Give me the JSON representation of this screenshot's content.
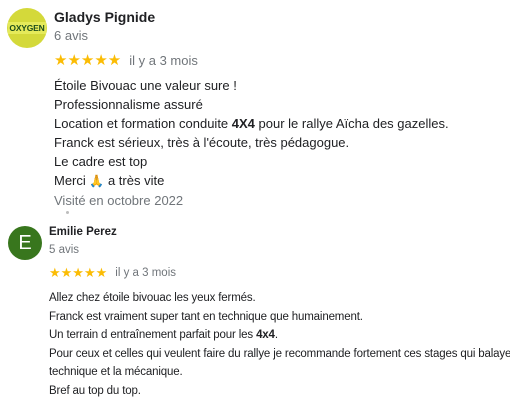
{
  "reviews": [
    {
      "avatar_brand": "OXYGEN",
      "author": "Gladys Pignide",
      "review_count": "6 avis",
      "stars": "★★★★★",
      "time": "il y a 3 mois",
      "lines": {
        "l1": "Étoile Bivouac une valeur sure !",
        "l2": "Professionnalisme assuré",
        "l3a": "Location et formation conduite ",
        "l3b": "4X4",
        "l3c": " pour le rallye Aïcha des gazelles.",
        "l4": "Franck est sérieux, très à l'écoute, très pédagogue.",
        "l5": "Le cadre est top",
        "l6a": "Merci ",
        "l6_emoji": "🙏",
        "l6b": " a très vite"
      },
      "visited": "Visité en octobre 2022"
    },
    {
      "avatar_letter": "E",
      "avatar_color": "#38761d",
      "author": "Emilie Perez",
      "review_count": "5 avis",
      "stars": "★★★★★",
      "time": "il y a 3 mois",
      "lines": {
        "l1": "Allez chez étoile bivouac les yeux fermés.",
        "l2": "Franck est vraiment super tant en technique que humainement.",
        "l3a": "Un terrain d entraînement parfait pour les ",
        "l3b": "4x4",
        "l3c": ".",
        "l4": "Pour ceux et celles qui veulent faire du rallye je recommande fortement ces stages qui balaye la",
        "l5": "technique et la mécanique.",
        "l6": "Bref au top du top."
      }
    }
  ]
}
